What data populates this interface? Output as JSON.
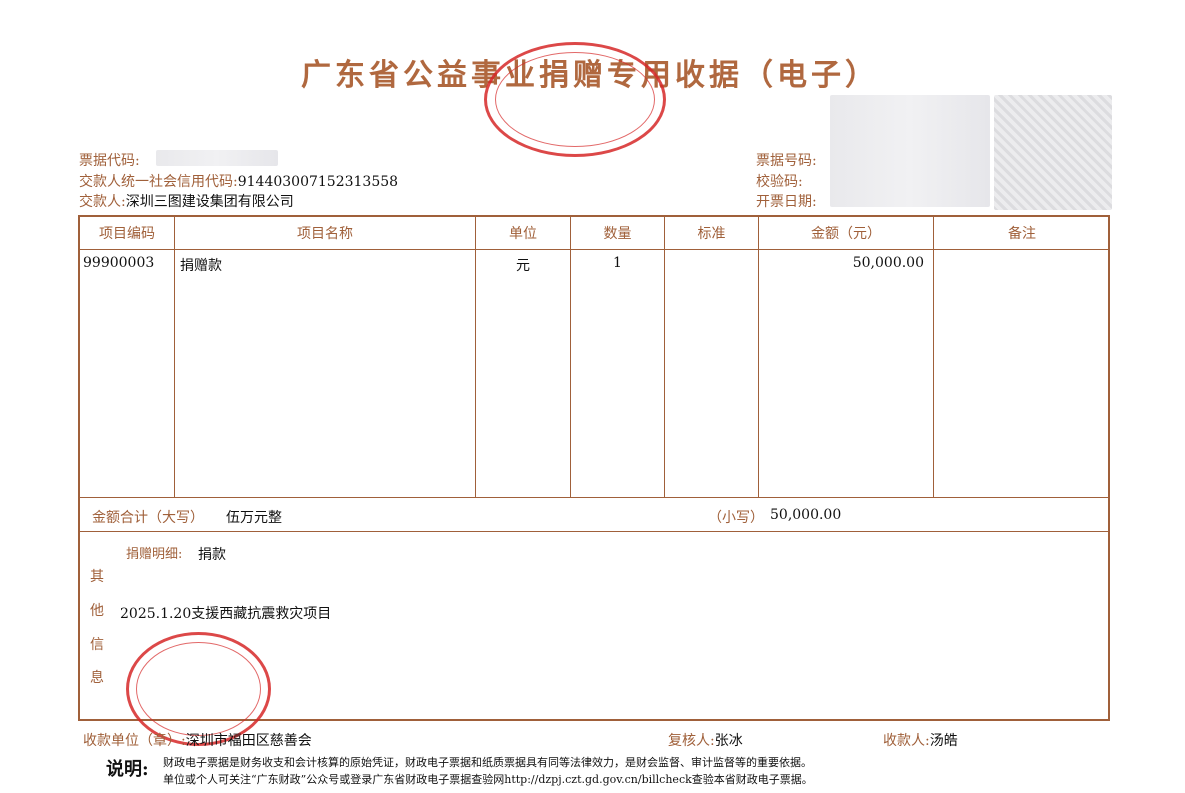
{
  "title": "广东省公益事业捐赠专用收据（电子）",
  "header": {
    "bill_code_label": "票据代码:",
    "bill_code": "",
    "credit_code_label": "交款人统一社会信用代码:",
    "credit_code": "914403007152313558",
    "payer_label": "交款人:",
    "payer": "深圳三图建设集团有限公司",
    "bill_no_label": "票据号码:",
    "bill_no": "",
    "check_code_label": "校验码:",
    "check_code": "",
    "issue_date_label": "开票日期:",
    "issue_date": ""
  },
  "table": {
    "headers": [
      "项目编码",
      "项目名称",
      "单位",
      "数量",
      "标准",
      "金额（元）",
      "备注"
    ],
    "rows": [
      {
        "code": "99900003",
        "name": "捐赠款",
        "unit": "元",
        "qty": "1",
        "standard": "",
        "amount": "50,000.00",
        "remark": ""
      }
    ],
    "total_upper_label": "金额合计（大写）",
    "total_upper": "伍万元整",
    "total_lower_label": "（小写）",
    "total_lower": "50,000.00",
    "other_info_label": [
      "其",
      "他",
      "信",
      "息"
    ],
    "donation_detail_label": "捐赠明细:",
    "donation_detail": "捐款",
    "note": "2025.1.20支援西藏抗震救灾项目"
  },
  "footer": {
    "receiver_label": "收款单位（章）:",
    "receiver": "深圳市福田区慈善会",
    "reviewer_label": "复核人:",
    "reviewer": "张冰",
    "payee_label": "收款人:",
    "payee": "汤皓",
    "explain_label": "说明:",
    "explain_line1": "财政电子票据是财务收支和会计核算的原始凭证，财政电子票据和纸质票据具有同等法律效力，是财会监督、审计监督等的重要依据。",
    "explain_line2": "单位或个人可关注“广东财政”公众号或登录广东省财政电子票据查验网http://dzpj.czt.gd.gov.cn/billcheck查验本省财政电子票据。"
  },
  "colors": {
    "accent": "#a0603a",
    "stamp": "#d62828"
  }
}
